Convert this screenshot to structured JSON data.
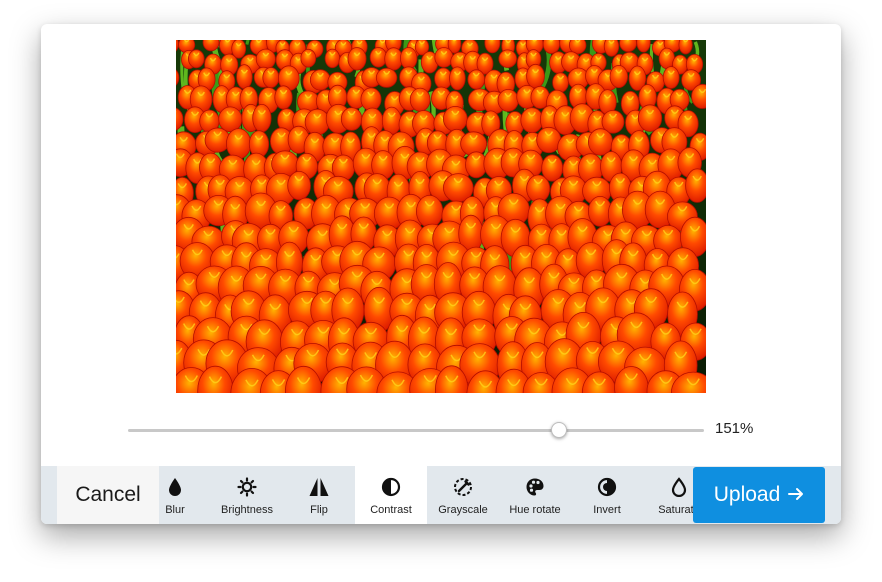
{
  "editor": {
    "zoom_percent": 151,
    "zoom_label": "151%",
    "slider_fraction": 0.748
  },
  "toolbar": {
    "cancel_label": "Cancel",
    "upload_label": "Upload",
    "upload_icon": "arrow-right-icon",
    "tools": [
      {
        "label": "Blur",
        "icon": "blur-drop-icon",
        "active": false
      },
      {
        "label": "Brightness",
        "icon": "brightness-sun-icon",
        "active": false
      },
      {
        "label": "Flip",
        "icon": "flip-icon",
        "active": false
      },
      {
        "label": "Contrast",
        "icon": "contrast-icon",
        "active": true
      },
      {
        "label": "Grayscale",
        "icon": "grayscale-icon",
        "active": false
      },
      {
        "label": "Hue rotate",
        "icon": "palette-icon",
        "active": false
      },
      {
        "label": "Invert",
        "icon": "invert-icon",
        "active": false
      },
      {
        "label": "Saturate",
        "icon": "saturate-icon",
        "active": false
      }
    ]
  },
  "colors": {
    "upload_bg": "#0f8fe0",
    "toolbar_bg": "#e2e8ed",
    "active_tool_bg": "#ffffff"
  }
}
